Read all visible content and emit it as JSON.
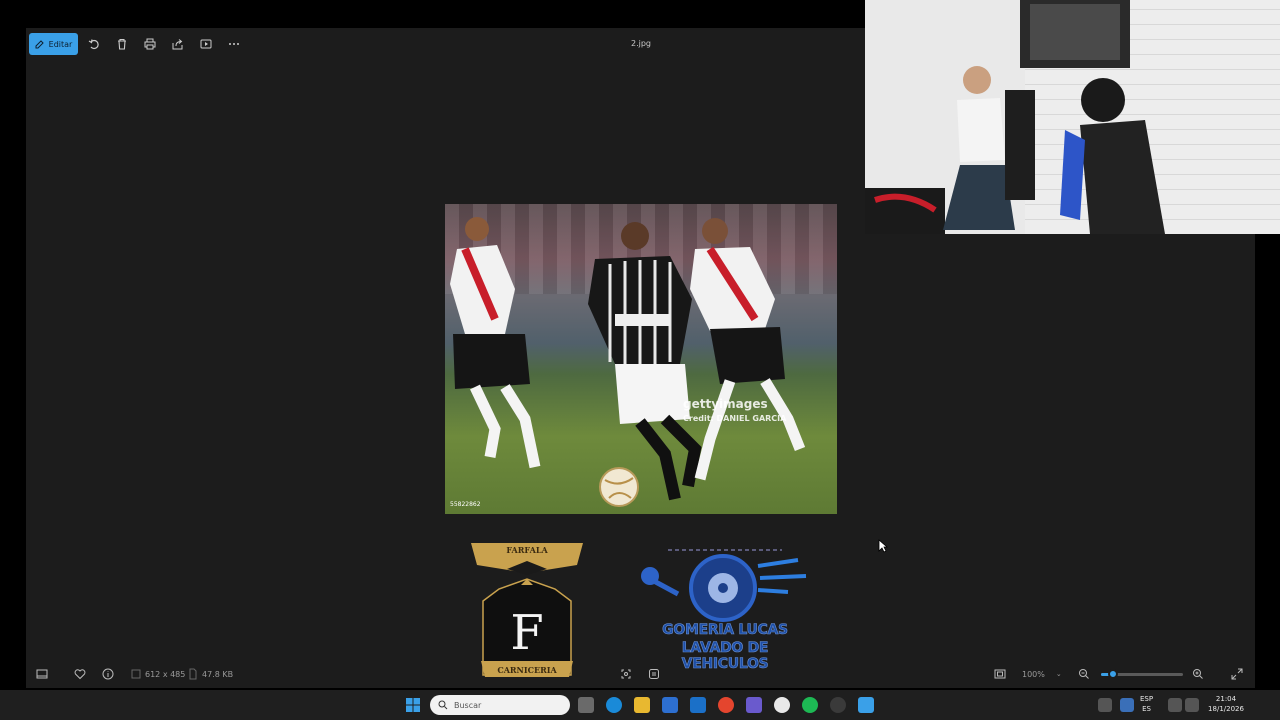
{
  "toolbar": {
    "edit_label": "Editar",
    "filename": "2.jpg",
    "icons": [
      "edit-icon",
      "rotate-icon",
      "delete-icon",
      "print-icon",
      "share-icon",
      "slideshow-icon",
      "more-icon"
    ]
  },
  "photo": {
    "watermark": "gettyimages",
    "credit": "Credit: DANIEL GARCIA",
    "image_id": "55822862"
  },
  "logos": {
    "left_top_banner": "FARFALA",
    "left_letter": "F",
    "left_bottom_banner": "CARNICERIA",
    "right_line1": "GOMERIA LUCAS",
    "right_line2": "LAVADO DE VEHICULOS"
  },
  "bottombar": {
    "dimensions": "612 x 485",
    "file_size": "47.8 KB",
    "zoom": "100%",
    "zoom_level_fraction": 0.15
  },
  "taskbar": {
    "search_placeholder": "Buscar",
    "lang_top": "ESP",
    "lang_bottom": "ES",
    "time": "21:04",
    "date": "18/1/2026"
  },
  "colors": {
    "accent": "#3aa0e8",
    "app_bg": "#1c1c1c",
    "taskbar_bg": "#1f1f1f"
  }
}
